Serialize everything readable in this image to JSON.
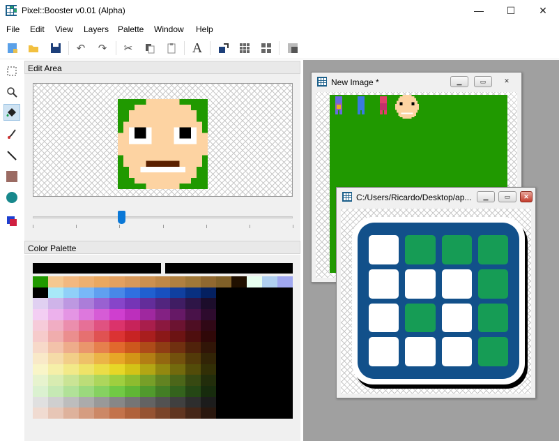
{
  "window": {
    "title": "Pixel::Booster v0.01 (Alpha)",
    "minimize_glyph": "—",
    "maximize_glyph": "☐",
    "close_glyph": "✕"
  },
  "menu": [
    "File",
    "Edit",
    "View",
    "Layers",
    "Palette",
    "Window",
    "Help"
  ],
  "toolbar": {
    "icons": [
      "new-file-icon",
      "open-folder-icon",
      "save-icon",
      "undo-icon",
      "redo-icon",
      "cut-icon",
      "copy-icon",
      "paste-icon",
      "text-icon",
      "swap-icon",
      "grid-icon",
      "tile-grid-icon",
      "layer-icon"
    ],
    "text_tool_glyph": "A"
  },
  "tools": {
    "icons": [
      "selection-icon",
      "zoom-icon",
      "fill-bucket-icon",
      "pen-icon",
      "line-icon",
      "rectangle-icon",
      "ellipse-icon",
      "color-swap-icon"
    ],
    "active": "fill-bucket-icon"
  },
  "edit_area": {
    "header": "Edit Area",
    "zoom_slider_position": 0.34
  },
  "color_palette": {
    "header": "Color Palette",
    "foreground": "#000000",
    "background": "#000000"
  },
  "documents": [
    {
      "title": "New Image *",
      "background": "#209900"
    },
    {
      "title": "C:/Users/Ricardo/Desktop/ap..."
    }
  ],
  "colors": {
    "accent": "#0a78d7",
    "canvas_green": "#209900",
    "face": "#fdd3a2",
    "app_blue": "#12508a",
    "app_green": "#169c55"
  }
}
